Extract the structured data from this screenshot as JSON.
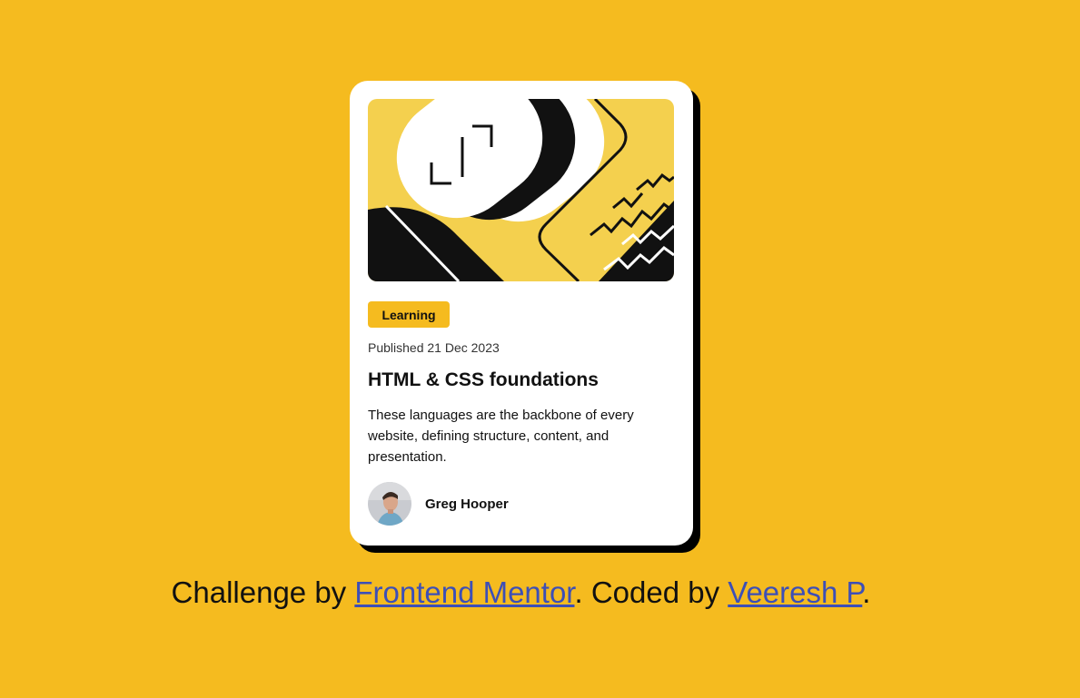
{
  "card": {
    "tag": "Learning",
    "published": "Published 21 Dec 2023",
    "title": "HTML & CSS foundations",
    "description": "These languages are the backbone of every website, defining structure, content, and presentation.",
    "author": "Greg Hooper"
  },
  "footer": {
    "prefix": "Challenge by ",
    "link1": "Frontend Mentor",
    "middle": ". Coded by ",
    "link2": "Veeresh P",
    "suffix": "."
  },
  "colors": {
    "background": "#F5BB1F",
    "card": "#FFFFFF",
    "shadow": "#000000",
    "link": "#3D4FB6"
  },
  "icons": {
    "hero": "abstract-illustration",
    "avatar": "author-avatar"
  }
}
